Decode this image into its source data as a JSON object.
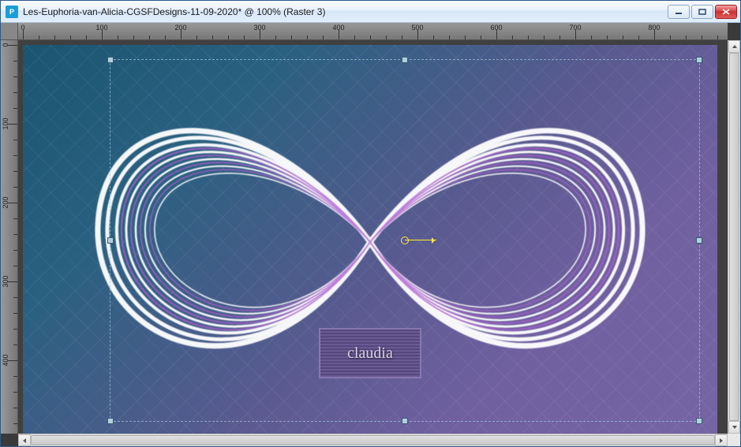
{
  "window": {
    "title": "Les-Euphoria-van-Alicia-CGSFDesigns-11-09-2020* @ 100% (Raster 3)",
    "app_icon_label": "P"
  },
  "controls": {
    "minimize": "minimize",
    "maximize": "maximize",
    "close": "close"
  },
  "document": {
    "zoom_percent": 100,
    "active_layer": "Raster 3",
    "filename": "Les-Euphoria-van-Alicia-CGSFDesigns-11-09-2020",
    "modified": true
  },
  "ruler": {
    "unit": "pixels",
    "h_majors": [
      0,
      100,
      200,
      300,
      400,
      500,
      600,
      700,
      800
    ],
    "v_majors": [
      0,
      100,
      200,
      300,
      400
    ]
  },
  "watermark": {
    "text": "claudia"
  },
  "colors": {
    "bg_start": "#1a5570",
    "bg_end": "#7565a5",
    "accent_white": "#ffffff",
    "accent_purple": "#a050c0"
  }
}
